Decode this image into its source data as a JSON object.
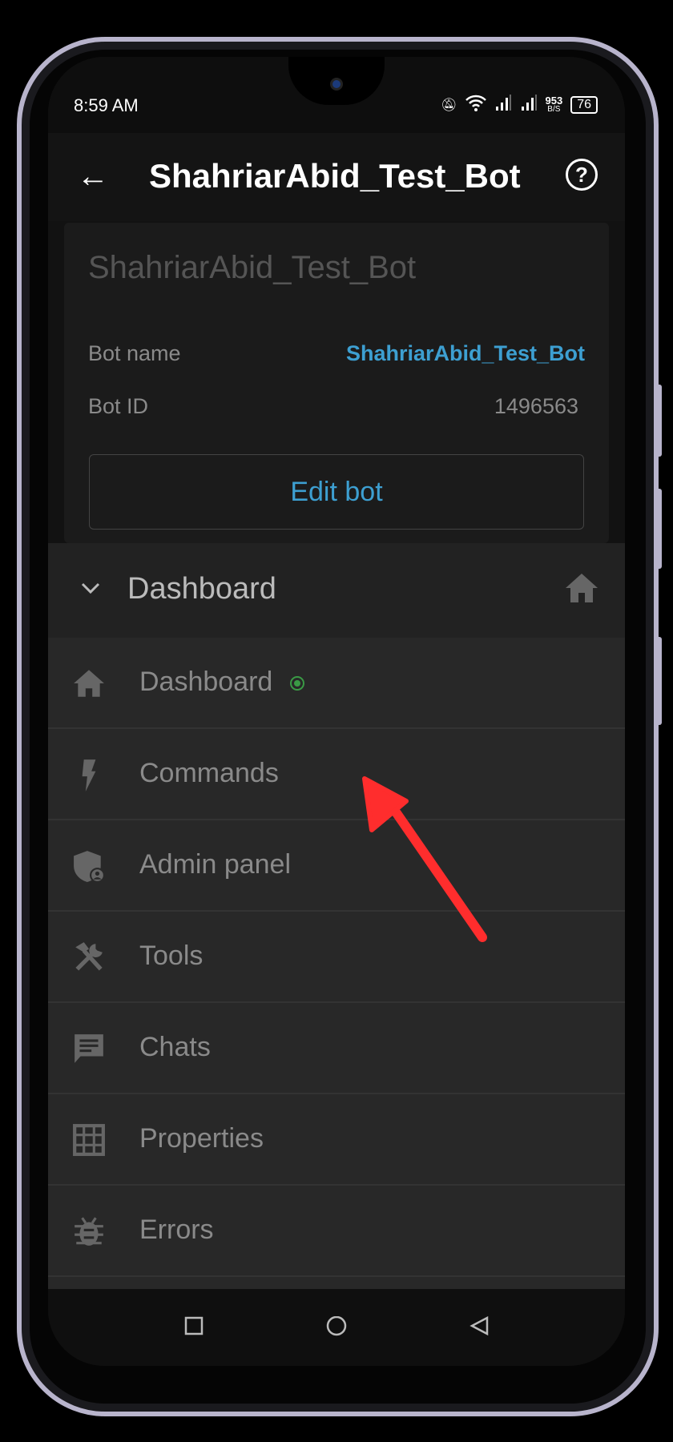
{
  "status_bar": {
    "time": "8:59 AM",
    "net_speed": "953",
    "net_unit": "B/S",
    "battery": "76"
  },
  "app_bar": {
    "title": "ShahriarAbid_Test_Bot",
    "back_icon": "arrow-left-icon",
    "help_icon": "help-circle-icon"
  },
  "bot_card": {
    "title": "ShahriarAbid_Test_Bot",
    "name_label": "Bot name",
    "name_value": "ShahriarAbid_Test_Bot",
    "id_label": "Bot ID",
    "id_value": "1496563",
    "edit_label": "Edit bot"
  },
  "section": {
    "title": "Dashboard",
    "icon": "home-icon"
  },
  "menu": [
    {
      "label": "Dashboard",
      "icon": "home-icon",
      "active": true
    },
    {
      "label": "Commands",
      "icon": "bolt-icon"
    },
    {
      "label": "Admin panel",
      "icon": "shield-user-icon"
    },
    {
      "label": "Tools",
      "icon": "tools-icon"
    },
    {
      "label": "Chats",
      "icon": "chat-icon"
    },
    {
      "label": "Properties",
      "icon": "grid-icon"
    },
    {
      "label": "Errors",
      "icon": "bug-icon"
    }
  ],
  "colors": {
    "accent": "#3d9fd1",
    "active_dot": "#3a9a45",
    "annotation_arrow": "#ff2d2d"
  }
}
